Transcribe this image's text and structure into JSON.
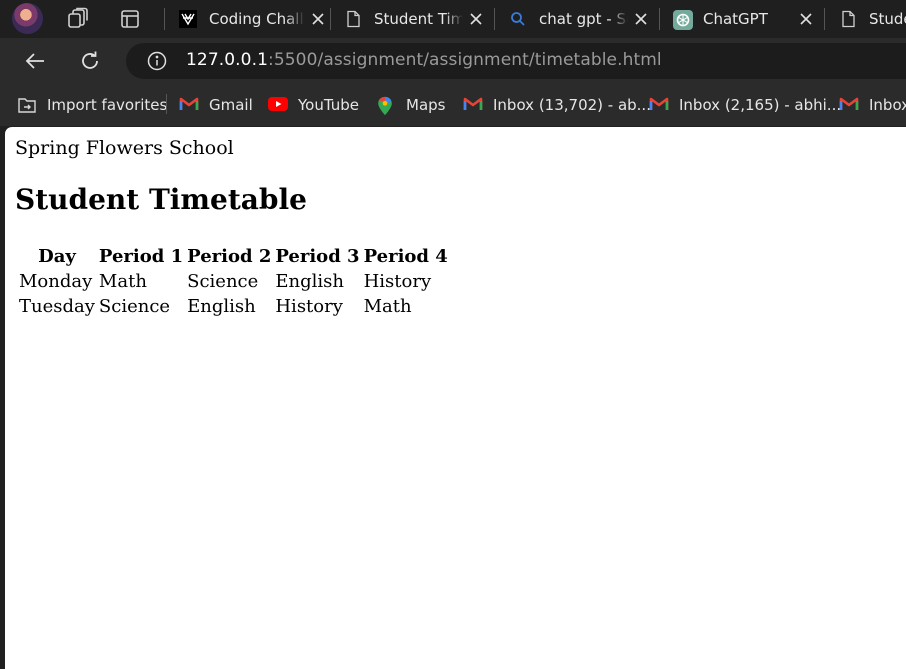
{
  "browser": {
    "tabs": [
      {
        "title": "Coding Challenges",
        "favicon": "code-logo-icon"
      },
      {
        "title": "Student Timetable",
        "favicon": "document-icon"
      },
      {
        "title": "chat gpt - Search",
        "favicon": "search-icon"
      },
      {
        "title": "ChatGPT",
        "favicon": "chatgpt-logo-icon"
      },
      {
        "title": "Student Timetable",
        "favicon": "document-icon"
      }
    ],
    "address": {
      "host": "127.0.0.1",
      "rest": ":5500/assignment/assignment/timetable.html"
    },
    "favorites": [
      {
        "label": "Import favorites",
        "icon": "import-favorites-icon"
      },
      {
        "label": "Gmail",
        "icon": "gmail-icon"
      },
      {
        "label": "YouTube",
        "icon": "youtube-icon"
      },
      {
        "label": "Maps",
        "icon": "maps-pin-icon"
      },
      {
        "label": "Inbox (13,702) - ab...",
        "icon": "gmail-icon"
      },
      {
        "label": "Inbox (2,165) - abhi...",
        "icon": "gmail-icon"
      },
      {
        "label": "Inbox",
        "icon": "gmail-icon"
      }
    ],
    "colors": {
      "youtube": "#ff0000",
      "gmail_red": "#ea4335",
      "chatgpt": "#74aa9c"
    }
  },
  "page": {
    "school_name": "Spring Flowers School",
    "heading": "Student Timetable",
    "table": {
      "headers": [
        "Day",
        "Period 1",
        "Period 2",
        "Period 3",
        "Period 4"
      ],
      "rows": [
        [
          "Monday",
          "Math",
          "Science",
          "English",
          "History"
        ],
        [
          "Tuesday",
          "Science",
          "English",
          "History",
          "Math"
        ]
      ]
    }
  }
}
